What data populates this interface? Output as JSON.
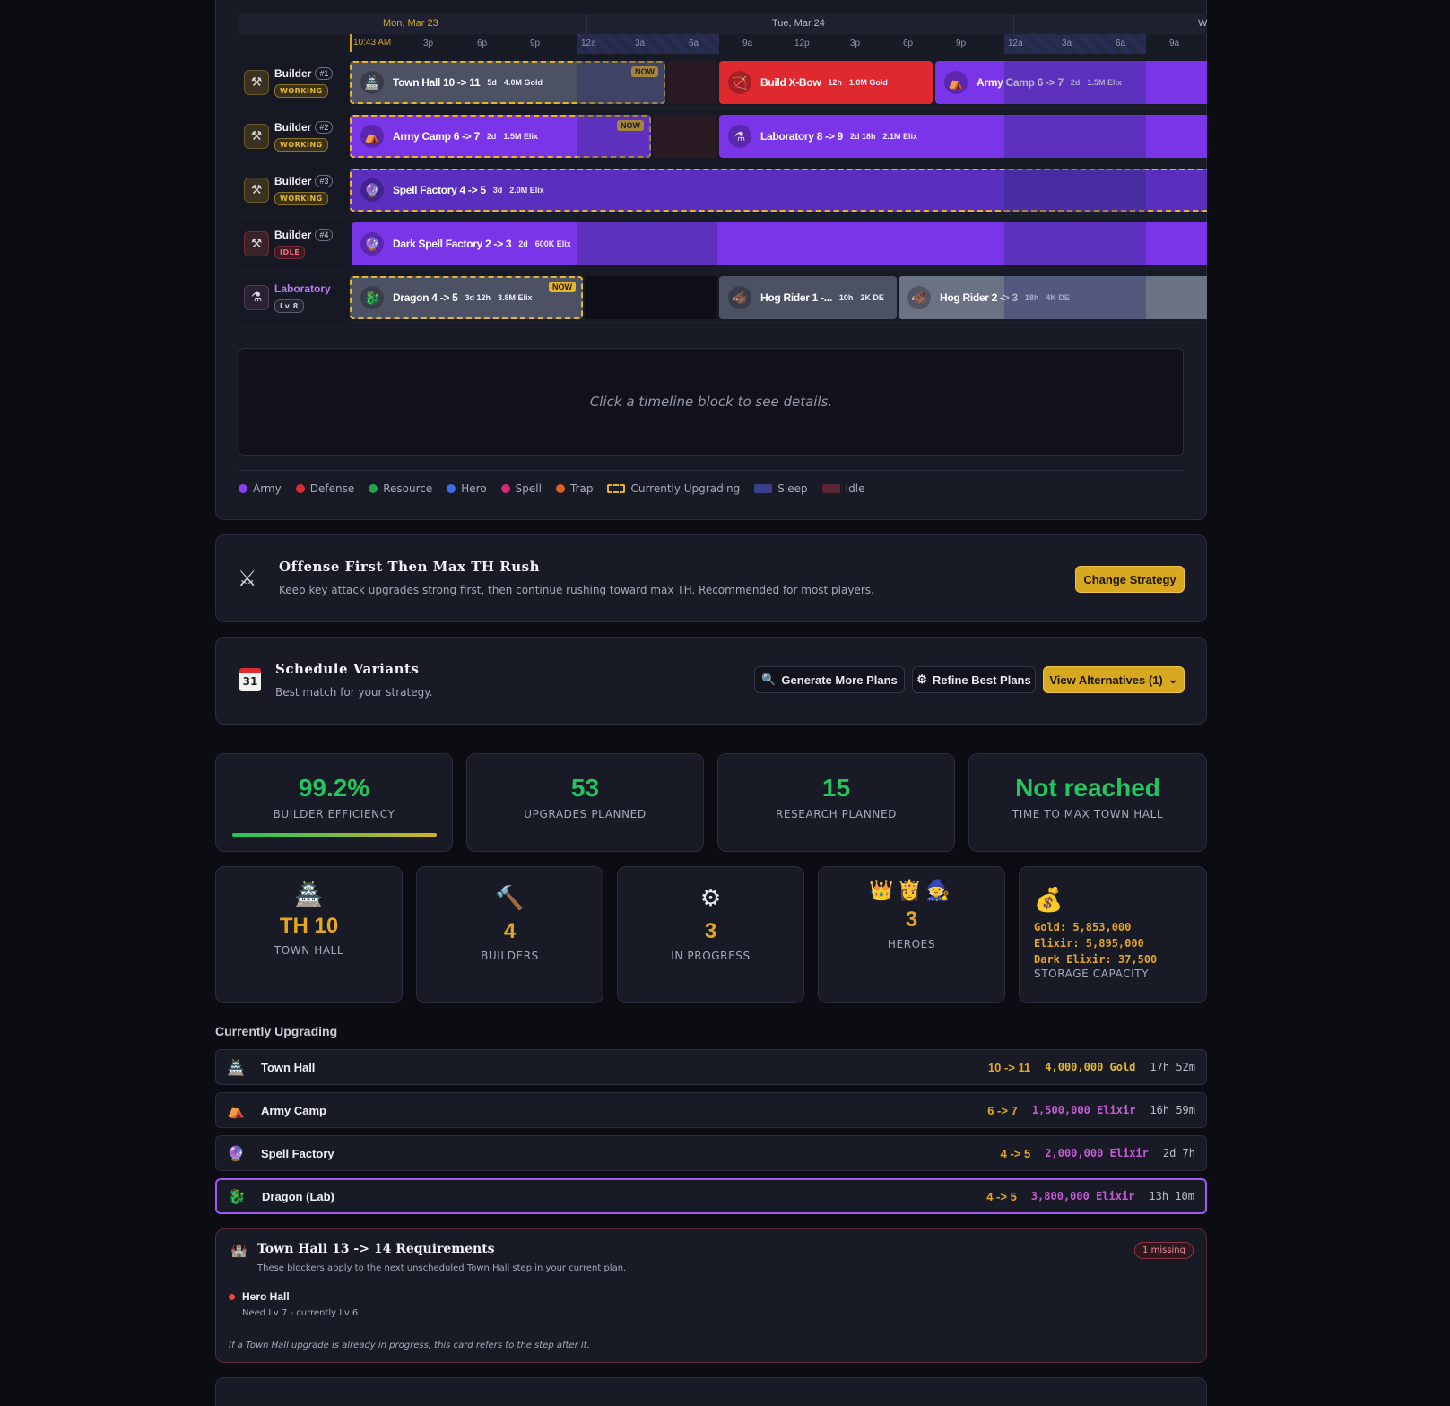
{
  "timeline": {
    "days": [
      "Mon, Mar 23",
      "Tue, Mar 24",
      "W"
    ],
    "now_time": "10:43 AM",
    "hours": [
      "3p",
      "6p",
      "9p",
      "12a",
      "3a",
      "6a",
      "9a",
      "12p",
      "3p",
      "6p",
      "9p",
      "12a",
      "3a",
      "6a",
      "9a"
    ],
    "now_badge": "NOW",
    "lanes": [
      {
        "name": "Builder",
        "num": "#1",
        "status": "WORKING"
      },
      {
        "name": "Builder",
        "num": "#2",
        "status": "WORKING"
      },
      {
        "name": "Builder",
        "num": "#3",
        "status": "WORKING"
      },
      {
        "name": "Builder",
        "num": "#4",
        "status": "IDLE"
      },
      {
        "name": "Laboratory",
        "num": "",
        "status": "Lv 8"
      }
    ],
    "blocks": {
      "b1a": {
        "title": "Town Hall 10 -> 11",
        "dur": "5d",
        "cost": "4.0M Gold"
      },
      "b1b": {
        "title": "Build X-Bow",
        "dur": "12h",
        "cost": "1.0M Gold"
      },
      "b1c": {
        "title": "Army Camp 6 -> 7",
        "dur": "2d",
        "cost": "1.5M Elix"
      },
      "b2a": {
        "title": "Army Camp 6 -> 7",
        "dur": "2d",
        "cost": "1.5M Elix"
      },
      "b2b": {
        "title": "Laboratory 8 -> 9",
        "dur": "2d 18h",
        "cost": "2.1M Elix"
      },
      "b3a": {
        "title": "Spell Factory 4 -> 5",
        "dur": "3d",
        "cost": "2.0M Elix"
      },
      "b4a": {
        "title": "Dark Spell Factory 2 -> 3",
        "dur": "2d",
        "cost": "600K Elix"
      },
      "l1": {
        "title": "Dragon 4 -> 5",
        "dur": "3d 12h",
        "cost": "3.8M Elix"
      },
      "l2": {
        "title": "Hog Rider 1 -...",
        "dur": "10h",
        "cost": "2K DE"
      },
      "l3": {
        "title": "Hog Rider 2 -> 3",
        "dur": "18h",
        "cost": "4K DE"
      }
    },
    "details_placeholder": "Click a timeline block to see details.",
    "legend": [
      {
        "label": "Army",
        "color": "#8b3cf0"
      },
      {
        "label": "Defense",
        "color": "#e0282f"
      },
      {
        "label": "Resource",
        "color": "#22a34a"
      },
      {
        "label": "Hero",
        "color": "#3b6ee8"
      },
      {
        "label": "Spell",
        "color": "#d42a7a"
      },
      {
        "label": "Trap",
        "color": "#e0601e"
      },
      {
        "label": "Currently Upgrading",
        "color": "#e5b726"
      },
      {
        "label": "Sleep",
        "color": "#3a3f8a"
      },
      {
        "label": "Idle",
        "color": "#5a2634"
      }
    ]
  },
  "strategy": {
    "title": "Offense First Then Max TH Rush",
    "description": "Keep key attack upgrades strong first, then continue rushing toward max TH. Recommended for most players.",
    "button": "Change Strategy"
  },
  "variants": {
    "title": "Schedule Variants",
    "subtitle": "Best match for your strategy.",
    "generate": "Generate More Plans",
    "refine": "Refine Best Plans",
    "view": "View Alternatives (1)"
  },
  "stats": {
    "efficiency": {
      "value": "99.2%",
      "label": "BUILDER EFFICIENCY"
    },
    "upgrades": {
      "value": "53",
      "label": "UPGRADES PLANNED"
    },
    "research": {
      "value": "15",
      "label": "RESEARCH PLANNED"
    },
    "max_th": {
      "value": "Not reached",
      "label": "TIME TO MAX TOWN HALL"
    }
  },
  "info": {
    "th": {
      "value": "TH 10",
      "label": "TOWN HALL"
    },
    "builders": {
      "value": "4",
      "label": "BUILDERS"
    },
    "progress": {
      "value": "3",
      "label": "IN PROGRESS"
    },
    "heroes": {
      "value": "3",
      "label": "HEROES"
    },
    "storage": {
      "gold": "Gold: 5,853,000",
      "elixir": "Elixir: 5,895,000",
      "dark": "Dark Elixir: 37,500",
      "label": "STORAGE CAPACITY"
    }
  },
  "currently_upgrading": {
    "title": "Currently Upgrading",
    "rows": [
      {
        "name": "Town Hall",
        "level": "10 -> 11",
        "cost": "4,000,000 Gold",
        "time": "17h 52m"
      },
      {
        "name": "Army Camp",
        "level": "6 -> 7",
        "cost": "1,500,000 Elixir",
        "time": "16h 59m"
      },
      {
        "name": "Spell Factory",
        "level": "4 -> 5",
        "cost": "2,000,000 Elixir",
        "time": "2d 7h"
      },
      {
        "name": "Dragon (Lab)",
        "level": "4 -> 5",
        "cost": "3,800,000 Elixir",
        "time": "13h 10m"
      }
    ]
  },
  "requirements": {
    "title": "Town Hall 13 -> 14 Requirements",
    "subtitle": "These blockers apply to the next unscheduled Town Hall step in your current plan.",
    "badge": "1 missing",
    "item": "Hero Hall",
    "need": "Need Lv 7 - currently Lv 6",
    "footnote": "If a Town Hall upgrade is already in progress, this card refers to the step after it."
  }
}
